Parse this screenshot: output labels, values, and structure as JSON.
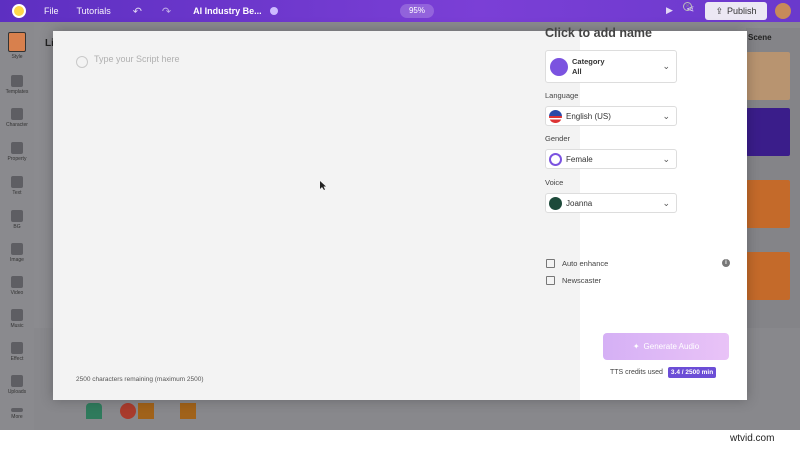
{
  "app": {
    "menu": [
      "File",
      "Tutorials"
    ],
    "project_title": "AI Industry Be...",
    "zoom": "95%",
    "publish_label": "Publish"
  },
  "sidebar": {
    "items": [
      {
        "label": "Style",
        "active": true
      },
      {
        "label": "Templates"
      },
      {
        "label": "Character"
      },
      {
        "label": "Property"
      },
      {
        "label": "Text"
      },
      {
        "label": "BG"
      },
      {
        "label": "Image"
      },
      {
        "label": "Video"
      },
      {
        "label": "Music"
      },
      {
        "label": "Effect"
      },
      {
        "label": "Uploads"
      },
      {
        "label": "More"
      }
    ]
  },
  "background": {
    "title_partial": "Li",
    "scene_heading": "Scene"
  },
  "script_panel": {
    "placeholder": "Type your Script here",
    "remaining_text": "2500 characters remaining (maximum 2500)"
  },
  "voice_panel": {
    "title": "Click to add name",
    "category": {
      "label": "Category",
      "value": "All"
    },
    "language": {
      "label": "Language",
      "value": "English (US)"
    },
    "gender": {
      "label": "Gender",
      "value": "Female"
    },
    "voice": {
      "label": "Voice",
      "value": "Joanna"
    },
    "options": [
      "Auto enhance",
      "Newscaster"
    ],
    "generate_label": "Generate Audio",
    "credits_label": "TTS credits used",
    "credits_value": "3.4 / 2500 min"
  },
  "watermark": "wtvid.com",
  "colors": {
    "accent": "#6c4ed6",
    "topbar": "#6a39cc",
    "generate_button": "#e0baf6"
  }
}
